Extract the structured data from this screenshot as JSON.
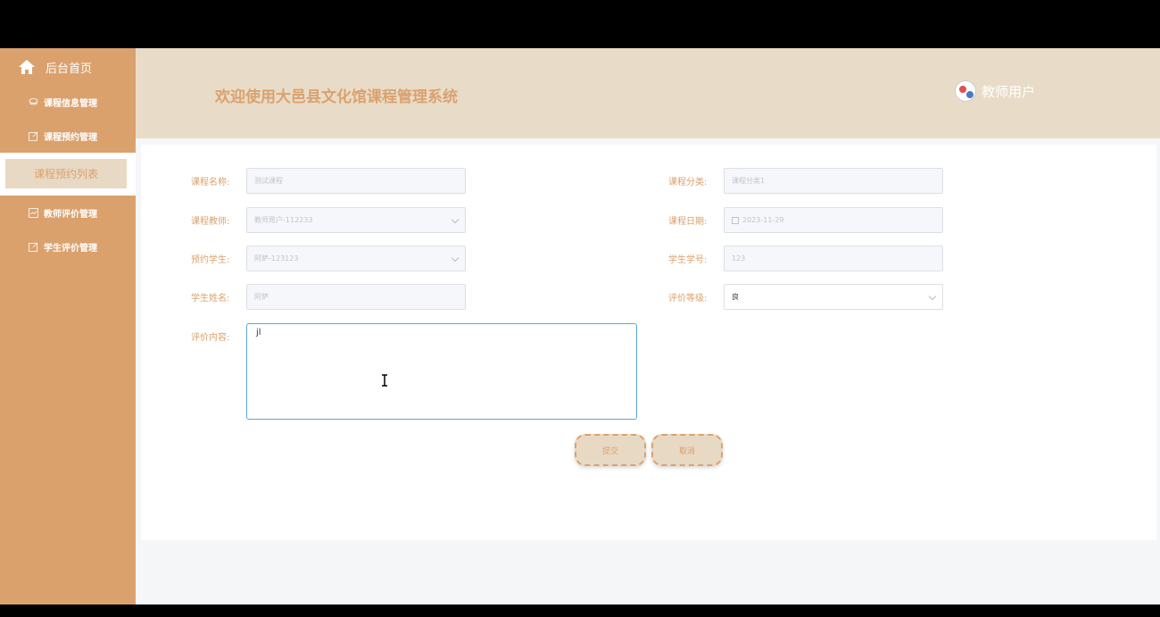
{
  "header": {
    "system_title": "欢迎使用大邑县文化馆课程管理系统",
    "user_label": "教师用户"
  },
  "sidebar": {
    "home_label": "后台首页",
    "items": [
      {
        "label": "课程信息管理"
      },
      {
        "label": "课程预约管理"
      },
      {
        "label": "教师评价管理"
      },
      {
        "label": "学生评价管理"
      }
    ],
    "active_submenu": "课程预约列表"
  },
  "form": {
    "course_name": {
      "label": "课程名称:",
      "value": "测试课程"
    },
    "course_category": {
      "label": "课程分类:",
      "value": "课程分类1"
    },
    "course_teacher": {
      "label": "课程教师:",
      "value": "教师用户-112233"
    },
    "course_date": {
      "label": "课程日期:",
      "value": "2023-11-29"
    },
    "booking_student": {
      "label": "预约学生:",
      "value": "阿萨-123123"
    },
    "student_number": {
      "label": "学生学号:",
      "value": "123"
    },
    "student_name": {
      "label": "学生姓名:",
      "value": "阿萨"
    },
    "rating_level": {
      "label": "评价等级:",
      "value": "良"
    },
    "review_content": {
      "label": "评价内容:",
      "value": "jl"
    }
  },
  "buttons": {
    "submit": "提交",
    "cancel": "取消"
  },
  "colors": {
    "accent": "#dba16d",
    "header_bg": "#e8dcc8"
  }
}
